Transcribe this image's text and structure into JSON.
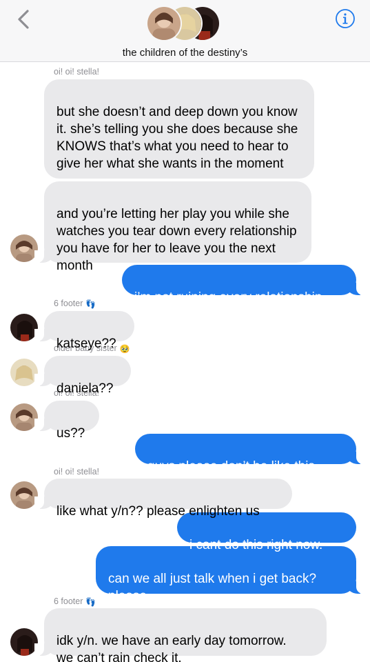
{
  "header": {
    "group_name": "the children of the destiny’s",
    "back_icon": "chevron-left-icon",
    "info_icon": "info-icon",
    "accent": "#1f7aec"
  },
  "messages": {
    "m1_sender": "oi! oi! stella!",
    "m1_text": "but she doesn’t and deep down you know it. she’s telling you she does because she KNOWS that’s what you need to hear to give her what she wants in the moment",
    "m2_text": "and you’re letting her play you while she watches you tear down every relationship you have for her to leave you the next month",
    "m3_text": "i’m not ruining every relationship",
    "m4_sender": "6 footer",
    "m4_sender_emoji": "👣",
    "m4_text": "katseye??",
    "m5_sender": "older baby sister",
    "m5_sender_emoji": "🥹",
    "m5_text": "daniela??",
    "m6_sender": "oi! oi! stella!",
    "m6_text": "us??",
    "m7_text": "guys please don’t be like this.",
    "m8_sender": "oi! oi! stella!",
    "m8_text": "like what y/n?? please enlighten us",
    "m9_text": "i cant do this right now.",
    "m10_text": "can we all just talk when i get back?\nplease.",
    "m11_sender": "6 footer",
    "m11_sender_emoji": "👣",
    "m11_text": "idk y/n. we have an early day tomorrow.\nwe can’t rain check it."
  }
}
